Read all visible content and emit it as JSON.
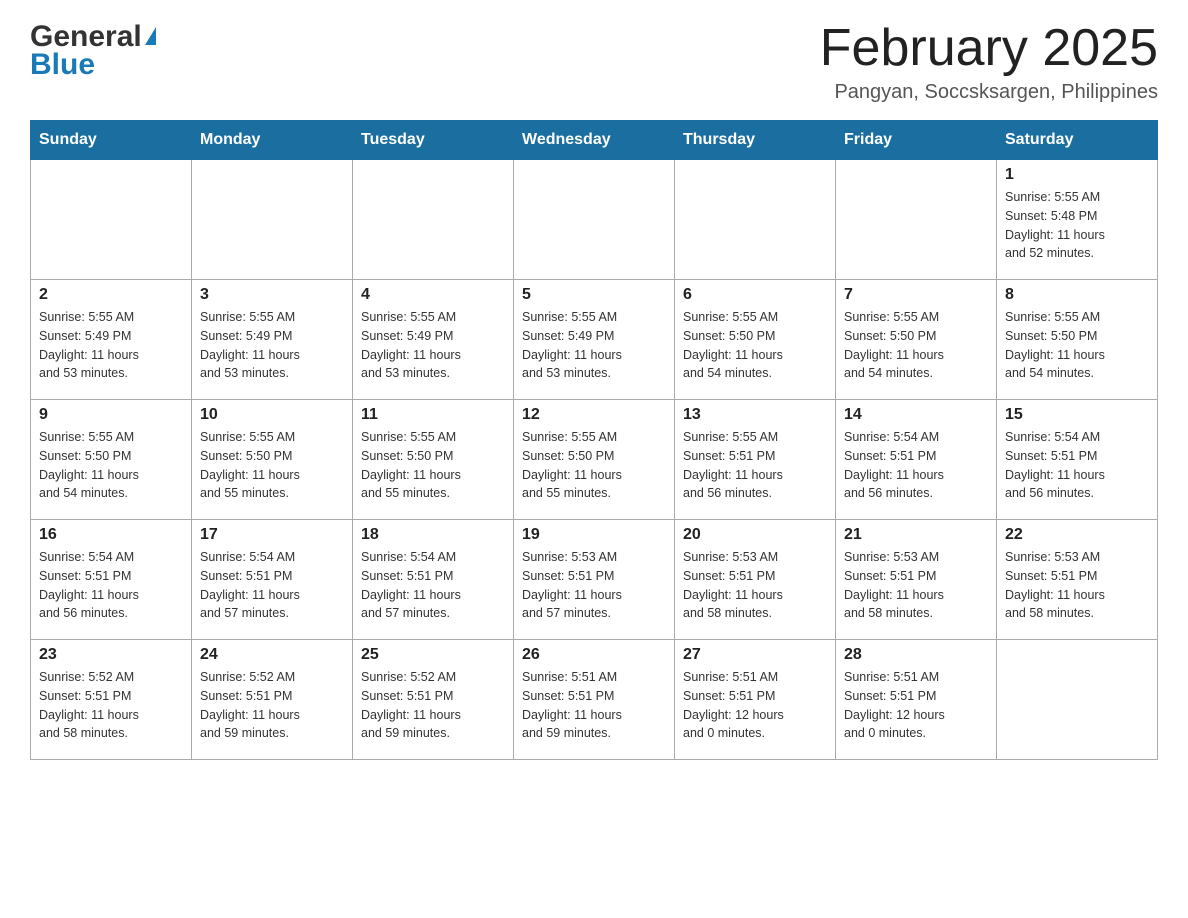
{
  "header": {
    "month_title": "February 2025",
    "location": "Pangyan, Soccsksargen, Philippines",
    "logo_general": "General",
    "logo_blue": "Blue"
  },
  "days_of_week": [
    "Sunday",
    "Monday",
    "Tuesday",
    "Wednesday",
    "Thursday",
    "Friday",
    "Saturday"
  ],
  "weeks": [
    {
      "days": [
        {
          "number": "",
          "info": ""
        },
        {
          "number": "",
          "info": ""
        },
        {
          "number": "",
          "info": ""
        },
        {
          "number": "",
          "info": ""
        },
        {
          "number": "",
          "info": ""
        },
        {
          "number": "",
          "info": ""
        },
        {
          "number": "1",
          "info": "Sunrise: 5:55 AM\nSunset: 5:48 PM\nDaylight: 11 hours\nand 52 minutes."
        }
      ]
    },
    {
      "days": [
        {
          "number": "2",
          "info": "Sunrise: 5:55 AM\nSunset: 5:49 PM\nDaylight: 11 hours\nand 53 minutes."
        },
        {
          "number": "3",
          "info": "Sunrise: 5:55 AM\nSunset: 5:49 PM\nDaylight: 11 hours\nand 53 minutes."
        },
        {
          "number": "4",
          "info": "Sunrise: 5:55 AM\nSunset: 5:49 PM\nDaylight: 11 hours\nand 53 minutes."
        },
        {
          "number": "5",
          "info": "Sunrise: 5:55 AM\nSunset: 5:49 PM\nDaylight: 11 hours\nand 53 minutes."
        },
        {
          "number": "6",
          "info": "Sunrise: 5:55 AM\nSunset: 5:50 PM\nDaylight: 11 hours\nand 54 minutes."
        },
        {
          "number": "7",
          "info": "Sunrise: 5:55 AM\nSunset: 5:50 PM\nDaylight: 11 hours\nand 54 minutes."
        },
        {
          "number": "8",
          "info": "Sunrise: 5:55 AM\nSunset: 5:50 PM\nDaylight: 11 hours\nand 54 minutes."
        }
      ]
    },
    {
      "days": [
        {
          "number": "9",
          "info": "Sunrise: 5:55 AM\nSunset: 5:50 PM\nDaylight: 11 hours\nand 54 minutes."
        },
        {
          "number": "10",
          "info": "Sunrise: 5:55 AM\nSunset: 5:50 PM\nDaylight: 11 hours\nand 55 minutes."
        },
        {
          "number": "11",
          "info": "Sunrise: 5:55 AM\nSunset: 5:50 PM\nDaylight: 11 hours\nand 55 minutes."
        },
        {
          "number": "12",
          "info": "Sunrise: 5:55 AM\nSunset: 5:50 PM\nDaylight: 11 hours\nand 55 minutes."
        },
        {
          "number": "13",
          "info": "Sunrise: 5:55 AM\nSunset: 5:51 PM\nDaylight: 11 hours\nand 56 minutes."
        },
        {
          "number": "14",
          "info": "Sunrise: 5:54 AM\nSunset: 5:51 PM\nDaylight: 11 hours\nand 56 minutes."
        },
        {
          "number": "15",
          "info": "Sunrise: 5:54 AM\nSunset: 5:51 PM\nDaylight: 11 hours\nand 56 minutes."
        }
      ]
    },
    {
      "days": [
        {
          "number": "16",
          "info": "Sunrise: 5:54 AM\nSunset: 5:51 PM\nDaylight: 11 hours\nand 56 minutes."
        },
        {
          "number": "17",
          "info": "Sunrise: 5:54 AM\nSunset: 5:51 PM\nDaylight: 11 hours\nand 57 minutes."
        },
        {
          "number": "18",
          "info": "Sunrise: 5:54 AM\nSunset: 5:51 PM\nDaylight: 11 hours\nand 57 minutes."
        },
        {
          "number": "19",
          "info": "Sunrise: 5:53 AM\nSunset: 5:51 PM\nDaylight: 11 hours\nand 57 minutes."
        },
        {
          "number": "20",
          "info": "Sunrise: 5:53 AM\nSunset: 5:51 PM\nDaylight: 11 hours\nand 58 minutes."
        },
        {
          "number": "21",
          "info": "Sunrise: 5:53 AM\nSunset: 5:51 PM\nDaylight: 11 hours\nand 58 minutes."
        },
        {
          "number": "22",
          "info": "Sunrise: 5:53 AM\nSunset: 5:51 PM\nDaylight: 11 hours\nand 58 minutes."
        }
      ]
    },
    {
      "days": [
        {
          "number": "23",
          "info": "Sunrise: 5:52 AM\nSunset: 5:51 PM\nDaylight: 11 hours\nand 58 minutes."
        },
        {
          "number": "24",
          "info": "Sunrise: 5:52 AM\nSunset: 5:51 PM\nDaylight: 11 hours\nand 59 minutes."
        },
        {
          "number": "25",
          "info": "Sunrise: 5:52 AM\nSunset: 5:51 PM\nDaylight: 11 hours\nand 59 minutes."
        },
        {
          "number": "26",
          "info": "Sunrise: 5:51 AM\nSunset: 5:51 PM\nDaylight: 11 hours\nand 59 minutes."
        },
        {
          "number": "27",
          "info": "Sunrise: 5:51 AM\nSunset: 5:51 PM\nDaylight: 12 hours\nand 0 minutes."
        },
        {
          "number": "28",
          "info": "Sunrise: 5:51 AM\nSunset: 5:51 PM\nDaylight: 12 hours\nand 0 minutes."
        },
        {
          "number": "",
          "info": ""
        }
      ]
    }
  ]
}
